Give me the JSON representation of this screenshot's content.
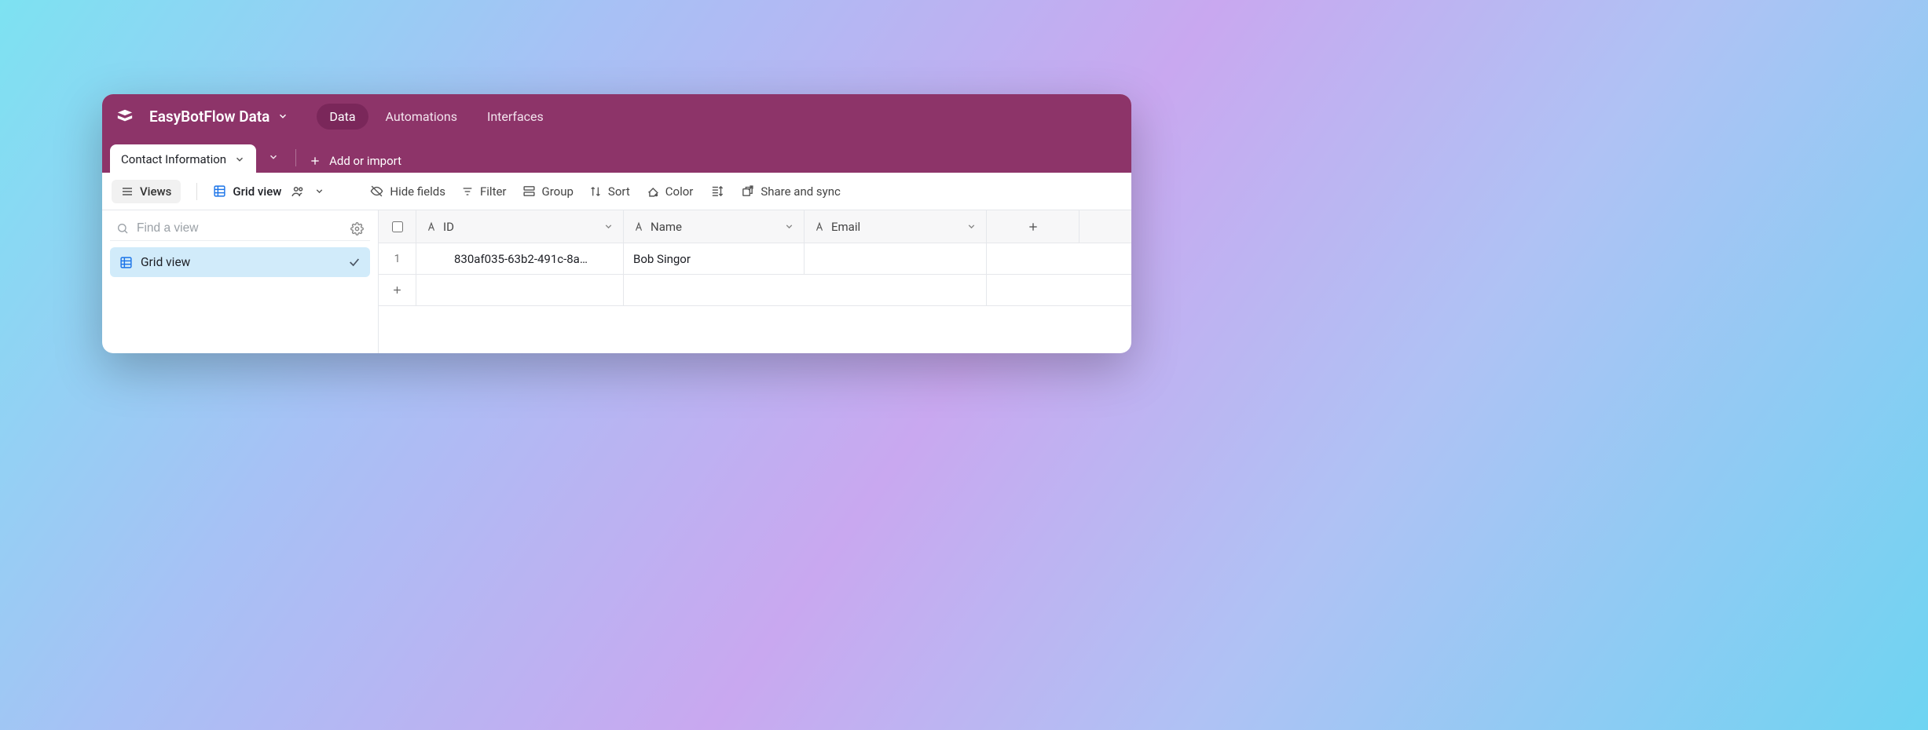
{
  "app": {
    "title": "EasyBotFlow Data"
  },
  "nav": {
    "tabs": [
      {
        "label": "Data",
        "active": true
      },
      {
        "label": "Automations",
        "active": false
      },
      {
        "label": "Interfaces",
        "active": false
      }
    ]
  },
  "table_tabs": {
    "active": {
      "label": "Contact Information"
    },
    "add_or_import": "Add or import"
  },
  "toolbar": {
    "views": "Views",
    "gridview": "Grid view",
    "hide_fields": "Hide fields",
    "filter": "Filter",
    "group": "Group",
    "sort": "Sort",
    "color": "Color",
    "share": "Share and sync"
  },
  "sidebar": {
    "find_placeholder": "Find a view",
    "views": [
      {
        "label": "Grid view",
        "selected": true
      }
    ]
  },
  "grid": {
    "columns": [
      {
        "key": "id",
        "label": "ID"
      },
      {
        "key": "name",
        "label": "Name"
      },
      {
        "key": "email",
        "label": "Email"
      }
    ],
    "rows": [
      {
        "num": "1",
        "id": "830af035-63b2-491c-8a…",
        "name": "Bob Singor",
        "email": ""
      }
    ]
  }
}
